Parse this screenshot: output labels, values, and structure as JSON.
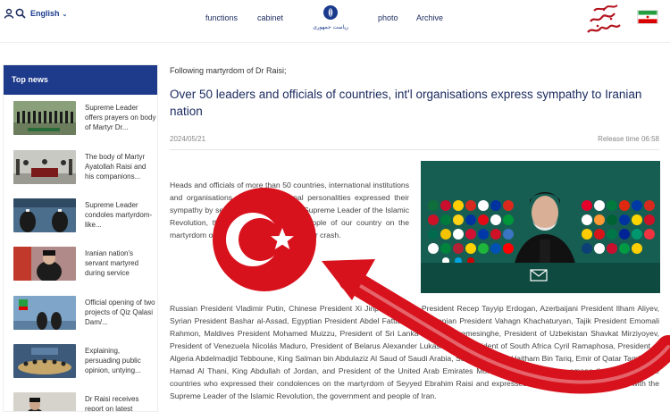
{
  "header": {
    "language": "English",
    "nav": [
      "functions",
      "cabinet",
      "photo",
      "Archive"
    ],
    "logo_caption": "ریاست جمهوری"
  },
  "sidebar": {
    "title": "Top news",
    "items": [
      {
        "text": "Supreme Leader offers prayers on body of Martyr Dr..."
      },
      {
        "text": "The body of Martyr Ayatollah Raisi and his companions..."
      },
      {
        "text": "Supreme Leader condoles martyrdom-like..."
      },
      {
        "text": "Iranian nation's servant martyred during service"
      },
      {
        "text": "Official opening of two projects of Qiz Qalasi Dam/..."
      },
      {
        "text": "Explaining, persuading public opinion, untying..."
      },
      {
        "text": "Dr Raisi receives report on latest"
      }
    ]
  },
  "article": {
    "kicker": "Following martyrdom of Dr Raisi;",
    "headline": "Over 50 leaders and officials of countries, int'l organisations express sympathy to Iranian nation",
    "date": "2024/05/21",
    "release_time": "Release time 06:58",
    "para1": "Heads and officials of more than 50 countries, international institutions and organisations and some regional personalities expressed their sympathy by sending messages to the Supreme Leader of the Islamic Revolution, the government and the people of our country on the martyrdom of the president in the helicopter crash.",
    "para2": "Russian President Vladimir Putin, Chinese President Xi Jinping, Turkish President Recep Tayyip Erdogan, Azerbaijani President Ilham Aliyev, Syrian President Bashar al-Assad, Egyptian President Abdel Fattah Sisi, Armenian President Vahagn Khachaturyan, Tajik President Emomali Rahmon, Maldives President Mohamed Muizzu, President of Sri Lanka Ranil Wickremesinghe, President of Uzbekistan Shavkat Mirziyoyev, President of Venezuela Nicolás Maduro, President of Belarus Alexander Lukashenko, President of South Africa Cyril Ramaphosa, President of Algeria Abdelmadjid Tebboune, King Salman bin Abdulaziz Al Saud of Saudi Arabia, Sultan of Oman Haitham Bin Tariq, Emir of Qatar Tamim Bin Hamad Al Thani, King Abdullah of Jordan, and President of the United Arab Emirates Mohamed Bin Zayed, are among the leaders of the countries who expressed their condolences on the martyrdom of Seyyed Ebrahim Raisi and expressed their sympathy and solidarity with the Supreme Leader of the Islamic Revolution, the government and people of Iran."
  },
  "colors": {
    "nav_blue": "#1a2a5e",
    "sidebar_header": "#1e3a8a",
    "overlay_red": "#d8121d",
    "photo_green": "#175e52"
  },
  "icons": [
    "user-icon",
    "search-icon",
    "chevron-down-icon",
    "emblem-icon",
    "calligraphy-logo",
    "iran-flag-icon",
    "turkey-flag-overlay",
    "red-arrow-overlay"
  ]
}
